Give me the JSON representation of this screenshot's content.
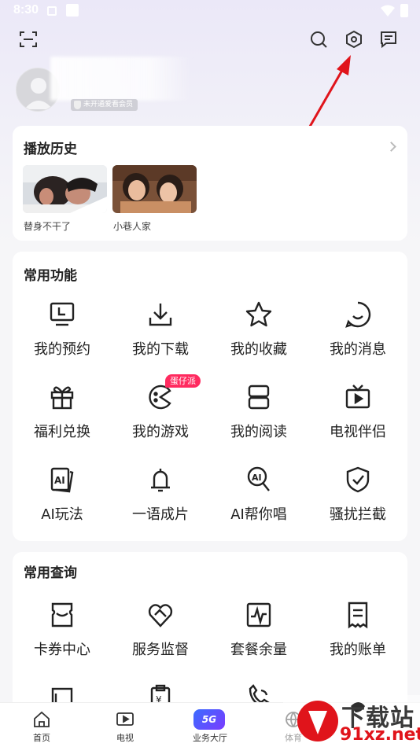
{
  "status_bar": {
    "time": "8:30"
  },
  "topbar": {
    "icons": [
      "scan-icon",
      "search-icon",
      "settings-icon",
      "message-icon"
    ]
  },
  "profile": {
    "member_badge": "未开通爱看会员"
  },
  "history": {
    "title": "播放历史",
    "items": [
      {
        "caption": "替身不干了"
      },
      {
        "caption": "小巷人家"
      }
    ]
  },
  "common_functions": {
    "title": "常用功能",
    "items": [
      {
        "label": "我的预约",
        "icon": "monitor-clock-icon"
      },
      {
        "label": "我的下载",
        "icon": "download-icon"
      },
      {
        "label": "我的收藏",
        "icon": "star-icon"
      },
      {
        "label": "我的消息",
        "icon": "smile-chat-icon"
      },
      {
        "label": "福利兑换",
        "icon": "gift-icon"
      },
      {
        "label": "我的游戏",
        "icon": "game-icon",
        "tag": "蛋仔派"
      },
      {
        "label": "我的阅读",
        "icon": "book-icon"
      },
      {
        "label": "电视伴侣",
        "icon": "tv-icon"
      },
      {
        "label": "AI玩法",
        "icon": "ai-cards-icon"
      },
      {
        "label": "一语成片",
        "icon": "bell-icon"
      },
      {
        "label": "AI帮你唱",
        "icon": "ai-mic-icon"
      },
      {
        "label": "骚扰拦截",
        "icon": "shield-check-icon"
      }
    ]
  },
  "common_queries": {
    "title": "常用查询",
    "items": [
      {
        "label": "卡券中心",
        "icon": "coupon-icon"
      },
      {
        "label": "服务监督",
        "icon": "handshake-heart-icon"
      },
      {
        "label": "套餐余量",
        "icon": "pulse-chart-icon"
      },
      {
        "label": "我的账单",
        "icon": "receipt-icon"
      }
    ]
  },
  "bottom_nav": [
    {
      "label": "首页",
      "icon": "home-icon"
    },
    {
      "label": "电视",
      "icon": "tv-play-icon"
    },
    {
      "label": "业务大厅",
      "icon": "5g-icon",
      "badge": "5G"
    },
    {
      "label": "体育",
      "icon": "sports-ball-icon"
    }
  ],
  "watermark": {
    "line1": "下载站",
    "line2": "91xz.net"
  },
  "colors": {
    "accent": "#ff2a5f",
    "annotation_arrow": "#e0141b"
  }
}
